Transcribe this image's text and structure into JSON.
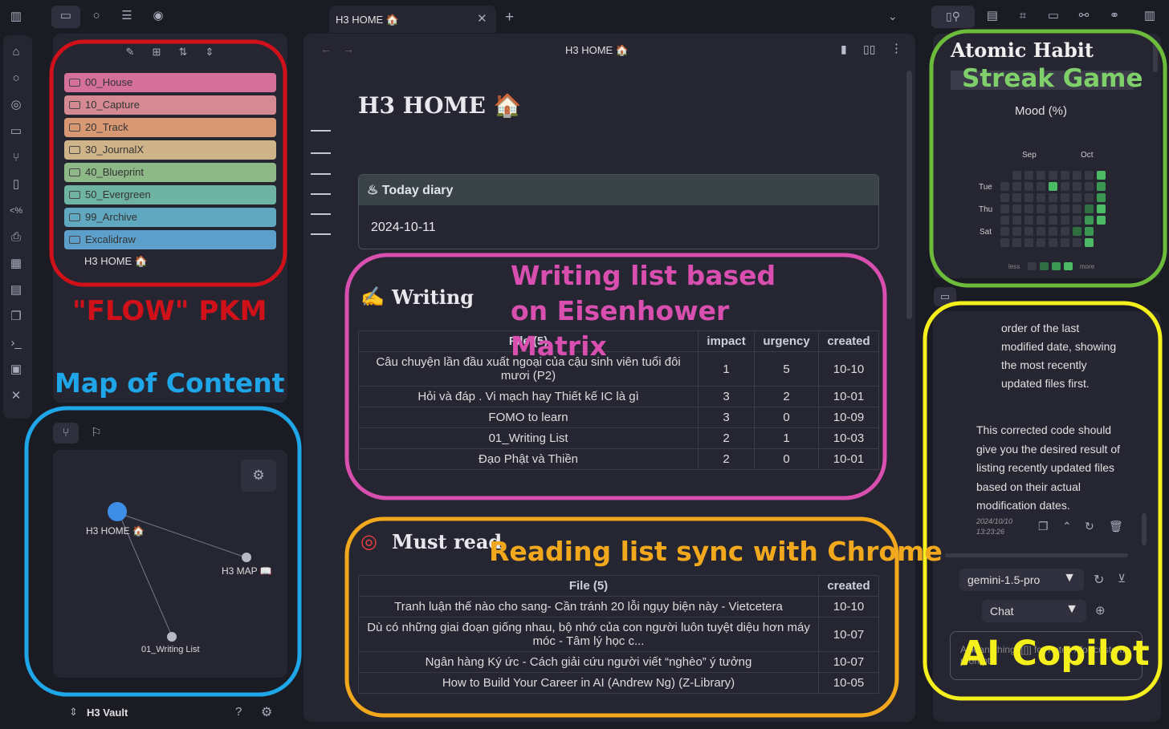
{
  "tabs": {
    "active": "H3 HOME 🏠",
    "new_tab": "+"
  },
  "editor": {
    "breadcrumb": "H3 HOME 🏠",
    "title": "H3 HOME 🏠"
  },
  "today_diary": {
    "label": "Today diary",
    "date": "2024-10-11"
  },
  "writing": {
    "heading": "Writing",
    "columns": [
      "File (5)",
      "impact",
      "urgency",
      "created"
    ],
    "rows": [
      [
        "Câu chuyện lần đầu xuất ngoại của cậu sinh viên tuổi đôi mươi (P2)",
        "1",
        "5",
        "10-10"
      ],
      [
        "Hỏi và đáp . Vi mạch hay Thiết kế IC là gì",
        "3",
        "2",
        "10-01"
      ],
      [
        "FOMO to learn",
        "3",
        "0",
        "10-09"
      ],
      [
        "01_Writing List",
        "2",
        "1",
        "10-03"
      ],
      [
        "Đạo Phật và Thiền",
        "2",
        "0",
        "10-01"
      ]
    ]
  },
  "must_read": {
    "heading": "Must read",
    "columns": [
      "File (5)",
      "created"
    ],
    "rows": [
      [
        "Tranh luận thế nào cho sang- Cần tránh 20 lỗi ngụy biện này - Vietcetera",
        "10-10"
      ],
      [
        "Dù có những giai đoạn giống nhau, bộ nhớ của con người luôn tuyệt diệu hơn máy móc - Tâm lý học c...",
        "10-07"
      ],
      [
        "Ngân hàng Ký ức - Cách giải cứu người viết “nghèo” ý tưởng",
        "10-07"
      ],
      [
        "How to Build Your Career in AI (Andrew Ng) (Z-Library)",
        "10-05"
      ]
    ]
  },
  "folders": [
    {
      "label": "00_House",
      "color": "#d4709a"
    },
    {
      "label": "10_Capture",
      "color": "#d58a93"
    },
    {
      "label": "20_Track",
      "color": "#d89873"
    },
    {
      "label": "30_JournalX",
      "color": "#cfb48a"
    },
    {
      "label": "40_Blueprint",
      "color": "#8fb888"
    },
    {
      "label": "50_Evergreen",
      "color": "#6fb3a2"
    },
    {
      "label": "99_Archive",
      "color": "#5fa8c0"
    },
    {
      "label": "Excalidraw",
      "color": "#5c9fcb"
    }
  ],
  "home_file": "H3 HOME 🏠",
  "graph": {
    "nodes": [
      "H3 HOME 🏠",
      "H3 MAP 📖",
      "01_Writing List"
    ]
  },
  "vault": {
    "name": "H3 Vault"
  },
  "heatmap": {
    "title1": "Atomic Habit",
    "title2": "Streak Game",
    "chart_title": "Mood (%)",
    "months": [
      "Sep",
      "Oct"
    ],
    "days": [
      "Tue",
      "Thu",
      "Sat"
    ],
    "legend_less": "less",
    "legend_more": "more"
  },
  "chat": {
    "message1": "order of the last modified date, showing the most recently updated files first.",
    "message2": "This corrected code should give you the desired result of listing recently updated files based on their actual modification dates.",
    "timestamp_date": "2024/10/10",
    "timestamp_time": "13:23:26",
    "model": "gemini-1.5-pro",
    "mode": "Chat",
    "input_placeholder": "Ask anything. [[]] for notes / for custom prompts"
  },
  "annotations": {
    "flow": "\"FLOW\" PKM",
    "moc": "Map of Content",
    "writing": "Writing list based on Eisenhower Matrix",
    "reading": "Reading list sync with Chrome",
    "copilot": "AI Copilot"
  },
  "colors": {
    "red": "#d0111a",
    "blue": "#1ea6e8",
    "pink": "#d94fb0",
    "orange": "#f2a81c",
    "green": "#6dbb3a",
    "yellow": "#f5f01c"
  }
}
